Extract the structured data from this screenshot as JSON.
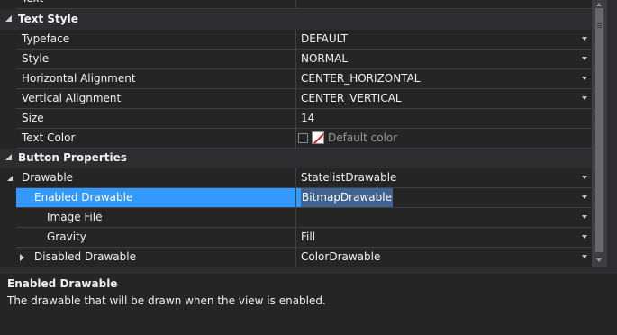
{
  "grid": {
    "partial_top_label": "Text",
    "text_style": {
      "category": "Text Style",
      "rows": [
        {
          "name": "Typeface",
          "value": "DEFAULT"
        },
        {
          "name": "Style",
          "value": "NORMAL"
        },
        {
          "name": "Horizontal Alignment",
          "value": "CENTER_HORIZONTAL"
        },
        {
          "name": "Vertical Alignment",
          "value": "CENTER_VERTICAL"
        },
        {
          "name": "Size",
          "value": "14"
        },
        {
          "name": "Text Color",
          "value": "Default color"
        }
      ]
    },
    "button_properties": {
      "category": "Button Properties",
      "drawable": {
        "name": "Drawable",
        "value": "StatelistDrawable"
      },
      "enabled_drawable": {
        "name": "Enabled Drawable",
        "value": "BitmapDrawable"
      },
      "image_file": {
        "name": "Image File",
        "value": ""
      },
      "gravity": {
        "name": "Gravity",
        "value": "Fill"
      },
      "disabled_drawable": {
        "name": "Disabled Drawable",
        "value": "ColorDrawable"
      }
    }
  },
  "description": {
    "title": "Enabled Drawable",
    "text": "The drawable that will be drawn when the view is enabled."
  },
  "colors": {
    "background": "#252526",
    "category_background": "#2d2d30",
    "selection": "#3399ff",
    "selected_value": "#3e6391",
    "separator": "#3f3f46"
  },
  "icons": {
    "expanded": "triangle-expanded-icon",
    "collapsed": "triangle-collapsed-icon",
    "dropdown": "dropdown-arrow-icon"
  }
}
